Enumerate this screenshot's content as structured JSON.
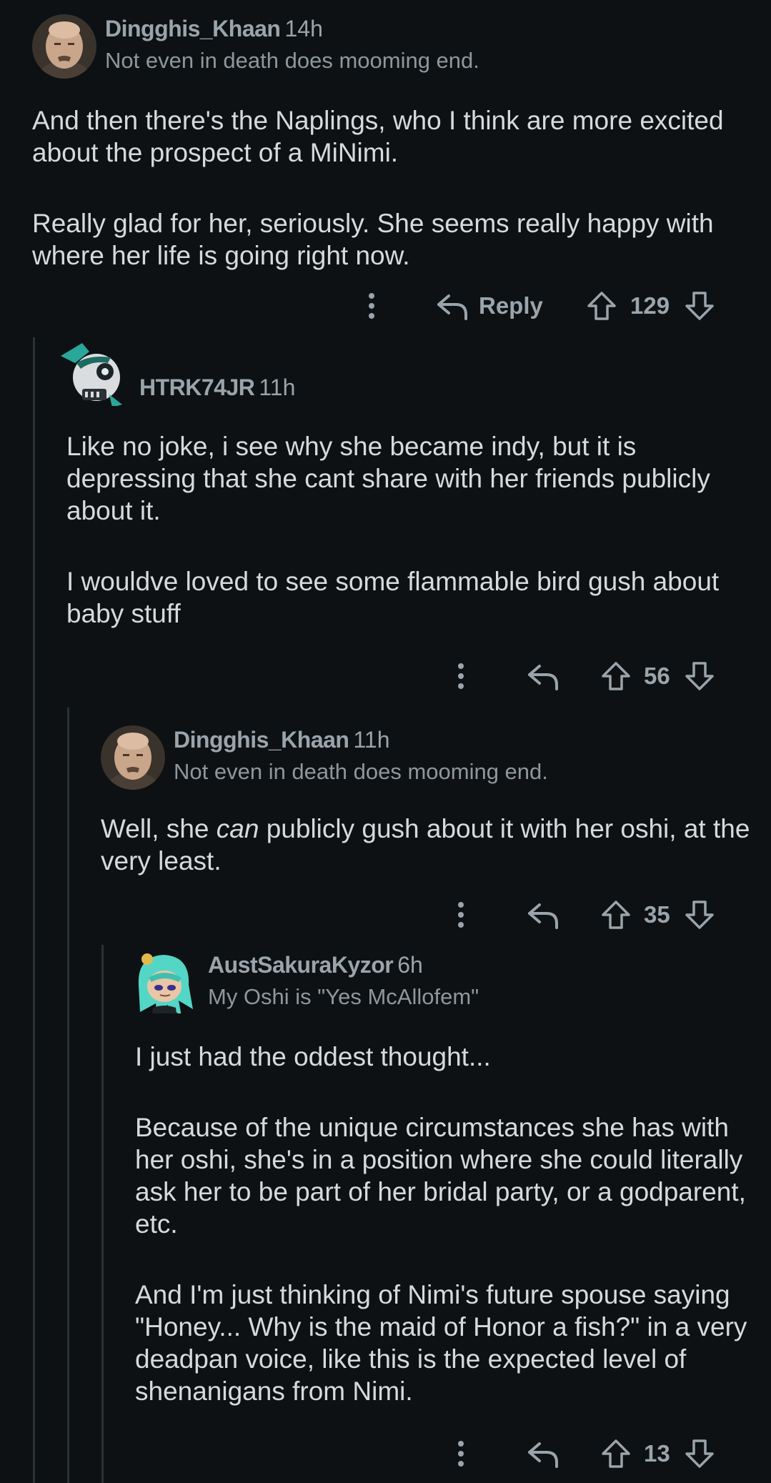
{
  "comments": [
    {
      "author": "Dingghis_Khaan",
      "time": "14h",
      "flair": "Not even in death does mooming end.",
      "body": [
        "And then there's the Naplings, who I think are more excited about the prospect of a MiNimi.",
        "Really glad for her, seriously. She seems really happy with where her life is going right now."
      ],
      "reply_label": "Reply",
      "score": "129",
      "avatar": "bald-man-portrait"
    },
    {
      "author": "HTRK74JR",
      "time": "11h",
      "body": [
        "Like no joke, i see why she became indy, but it is depressing that she cant share with her friends publicly about it.",
        "I wouldve loved to see some flammable bird gush about baby stuff"
      ],
      "score": "56",
      "avatar": "teal-robot-skull"
    },
    {
      "author": "Dingghis_Khaan",
      "time": "11h",
      "flair": "Not even in death does mooming end.",
      "body_pre": "Well, she ",
      "body_em": "can",
      "body_post": " publicly gush about it with her oshi, at the very least.",
      "score": "35",
      "avatar": "bald-man-portrait"
    },
    {
      "author": "AustSakuraKyzor",
      "time": "6h",
      "flair": "My Oshi is \"Yes McAllofem\"",
      "body": [
        "I just had the oddest thought...",
        "Because of the unique circumstances she has with her oshi, she's in a position where she could literally ask her to be part of her bridal party, or a godparent, etc.",
        "And I'm just thinking of Nimi's future spouse saying \"Honey... Why is the maid of Honor a fish?\" in a very deadpan voice, like this is the expected level of shenanigans from Nimi."
      ],
      "score": "13",
      "avatar": "teal-hair-anime-character"
    }
  ],
  "colors": {
    "background": "#0e1113",
    "text": "#d7dadc",
    "muted": "#9aa4ab",
    "thread_line": "#2a3236"
  },
  "icons": [
    "more-vertical-icon",
    "reply-arrow-icon",
    "upvote-arrow-icon",
    "downvote-arrow-icon"
  ]
}
